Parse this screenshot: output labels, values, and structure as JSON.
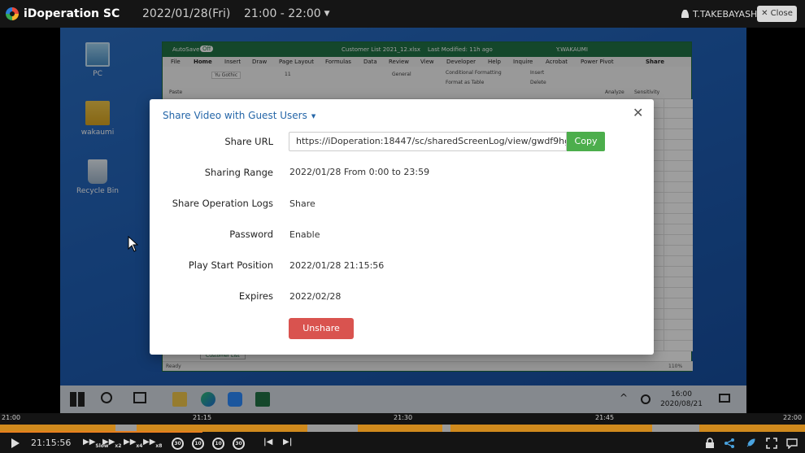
{
  "topbar": {
    "brand": "iDoperation SC",
    "date": "2022/01/28(Fri)",
    "time_range": "21:00 - 22:00",
    "user": "T.TAKEBAYASHI",
    "close_label": "Close"
  },
  "desktop": {
    "icons": [
      {
        "label": "PC",
        "icon": "computer-icon"
      },
      {
        "label": "wakaumi",
        "icon": "user-folder-icon"
      },
      {
        "label": "Recycle Bin",
        "icon": "recycle-bin-icon"
      }
    ]
  },
  "excel": {
    "autosave": "AutoSave",
    "toggle": "Off",
    "filename": "Customer List 2021_12.xlsx",
    "modified": "Last Modified: 11h ago",
    "account": "Y.WAKAUMI",
    "menu": [
      "File",
      "Home",
      "Insert",
      "Draw",
      "Page Layout",
      "Formulas",
      "Data",
      "Review",
      "View",
      "Developer",
      "Help",
      "Inquire",
      "Acrobat",
      "Power Pivot"
    ],
    "share": "Share",
    "font": "Yu Gothic",
    "font_size": "11",
    "number_format": "General",
    "conditional": "Conditional Formatting",
    "format_table": "Format as Table",
    "insert": "Insert",
    "delete": "Delete",
    "analyze": "Analyze",
    "sensitivity": "Sensitivity",
    "paste": "Paste",
    "sheet_tab": "Customer List",
    "status": "Ready",
    "zoom": "110%"
  },
  "taskbar": {
    "clock_time": "16:00",
    "clock_date": "2020/08/21"
  },
  "modal": {
    "title": "Share Video with Guest Users",
    "rows": [
      {
        "label": "Share URL",
        "value": "https://iDoperation:18447/sc/sharedScreenLog/view/gwdf9hga7"
      },
      {
        "label": "Sharing Range",
        "value": "2022/01/28 From 0:00 to 23:59"
      },
      {
        "label": "Share Operation Logs",
        "value": "Share"
      },
      {
        "label": "Password",
        "value": "Enable"
      },
      {
        "label": "Play Start Position",
        "value": "2022/01/28 21:15:56"
      },
      {
        "label": "Expires",
        "value": "2022/02/28"
      }
    ],
    "copy_label": "Copy",
    "unshare_label": "Unshare"
  },
  "player": {
    "ticks": [
      "21:00",
      "21:15",
      "21:30",
      "21:45",
      "22:00"
    ],
    "current_time": "21:15:56",
    "progress_fraction": 0.2517,
    "speeds": [
      "Slow",
      "x2",
      "x4",
      "x8"
    ],
    "skip_labels": [
      "30",
      "10",
      "10",
      "30"
    ],
    "colors": {
      "recorded": "#d08a1d",
      "gap": "#9a9a9a",
      "progress": "#e87f1f"
    }
  }
}
